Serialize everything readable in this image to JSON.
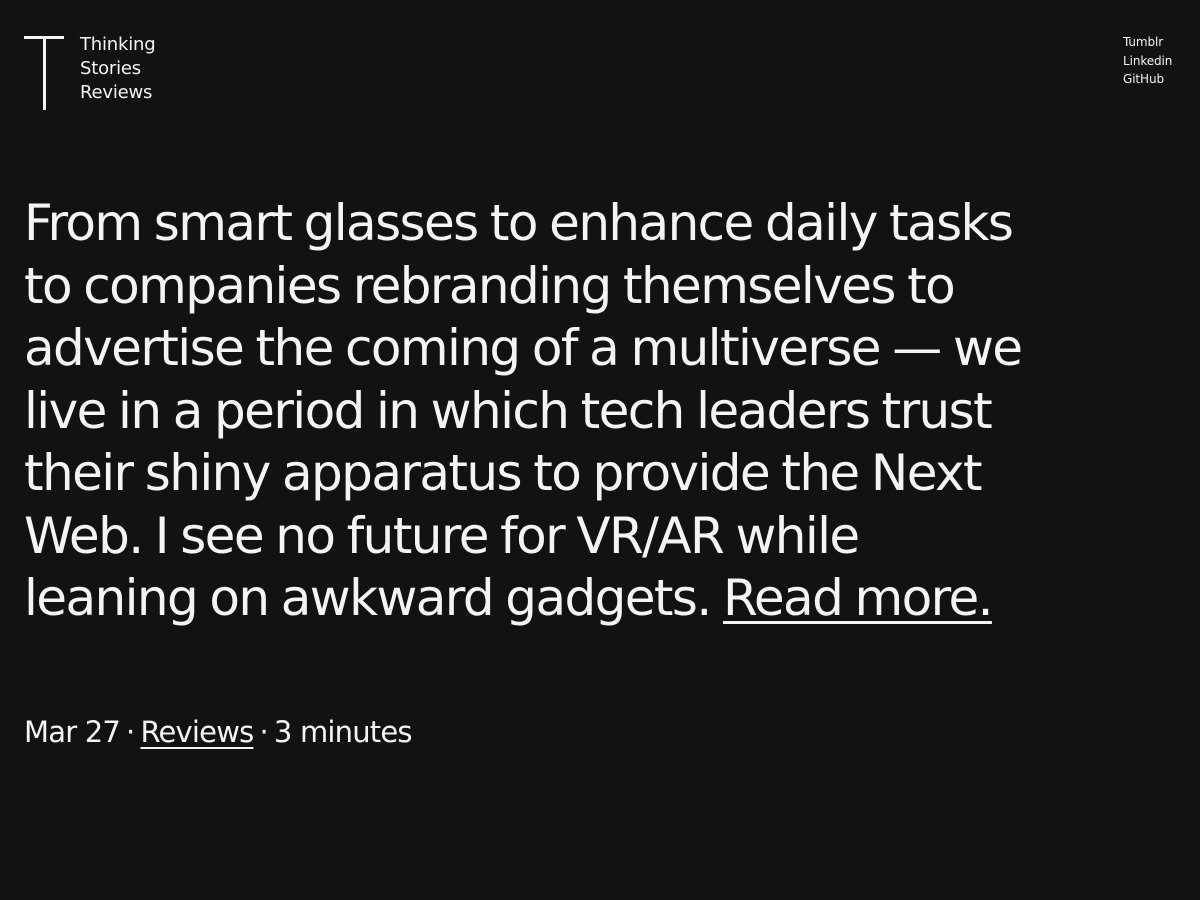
{
  "header": {
    "logo_icon": "letter-t-logo-icon",
    "nav": [
      {
        "label": "Thinking"
      },
      {
        "label": "Stories"
      },
      {
        "label": "Reviews"
      }
    ],
    "social": [
      {
        "label": "Tumblr"
      },
      {
        "label": "Linkedin"
      },
      {
        "label": "GitHub"
      }
    ]
  },
  "post": {
    "excerpt": "From smart glasses to enhance daily tasks to companies rebranding themselves to advertise the coming of a multiverse — we live in a period in which tech leaders trust their shiny apparatus to provide the Next Web. I see no future for VR/AR while leaning on awkward gadgets.",
    "read_more_label": "Read more.",
    "date": "Mar 27",
    "separator": "·",
    "category": "Reviews",
    "read_time": "3 minutes"
  },
  "colors": {
    "background": "#121212",
    "text": "#f4f4f4"
  }
}
